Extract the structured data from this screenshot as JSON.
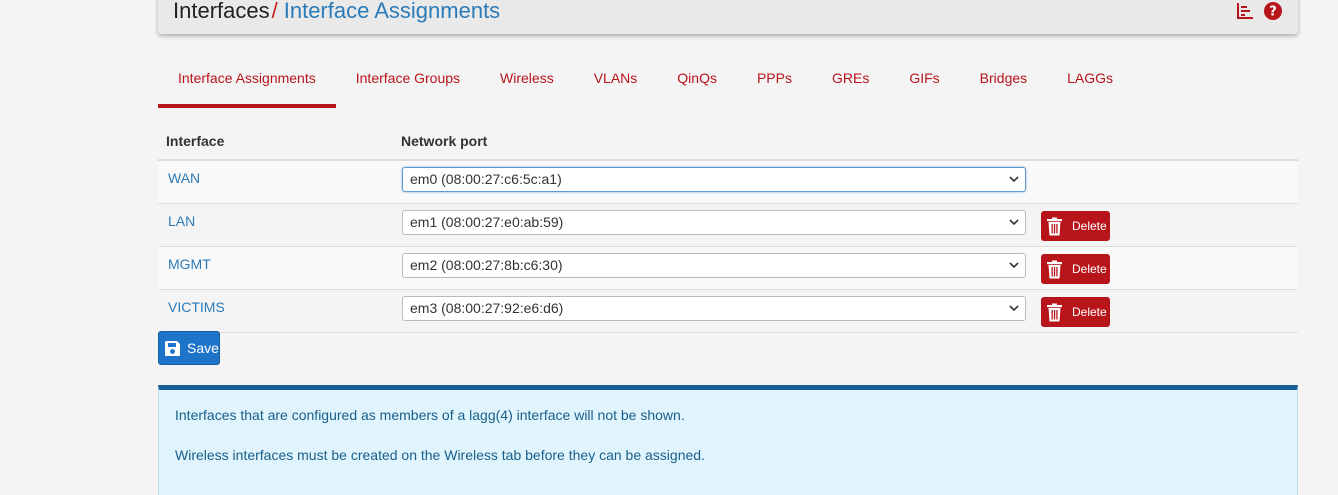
{
  "breadcrumb": {
    "root": "Interfaces",
    "separator": "/",
    "current": "Interface Assignments"
  },
  "header_icons": [
    "bar-chart-icon",
    "help-icon"
  ],
  "tabs": [
    {
      "label": "Interface Assignments",
      "active": true
    },
    {
      "label": "Interface Groups"
    },
    {
      "label": "Wireless"
    },
    {
      "label": "VLANs"
    },
    {
      "label": "QinQs"
    },
    {
      "label": "PPPs"
    },
    {
      "label": "GREs"
    },
    {
      "label": "GIFs"
    },
    {
      "label": "Bridges"
    },
    {
      "label": "LAGGs"
    }
  ],
  "table": {
    "headers": {
      "interface": "Interface",
      "network_port": "Network port"
    },
    "rows": [
      {
        "interface": "WAN",
        "port": "em0 (08:00:27:c6:5c:a1)",
        "deletable": false
      },
      {
        "interface": "LAN",
        "port": "em1 (08:00:27:e0:ab:59)",
        "deletable": true
      },
      {
        "interface": "MGMT",
        "port": "em2 (08:00:27:8b:c6:30)",
        "deletable": true
      },
      {
        "interface": "VICTIMS",
        "port": "em3 (08:00:27:92:e6:d6)",
        "deletable": true
      }
    ],
    "delete_label": "Delete"
  },
  "save_label": "Save",
  "info": {
    "line1": "Interfaces that are configured as members of a lagg(4) interface will not be shown.",
    "line2": "Wireless interfaces must be created on the Wireless tab before they can be assigned."
  },
  "colors": {
    "accent_red": "#b8151b",
    "link_blue": "#2b7bb9",
    "save_blue": "#1e74c9",
    "info_bg": "#dff4fc",
    "info_border": "#1a5e9c"
  }
}
